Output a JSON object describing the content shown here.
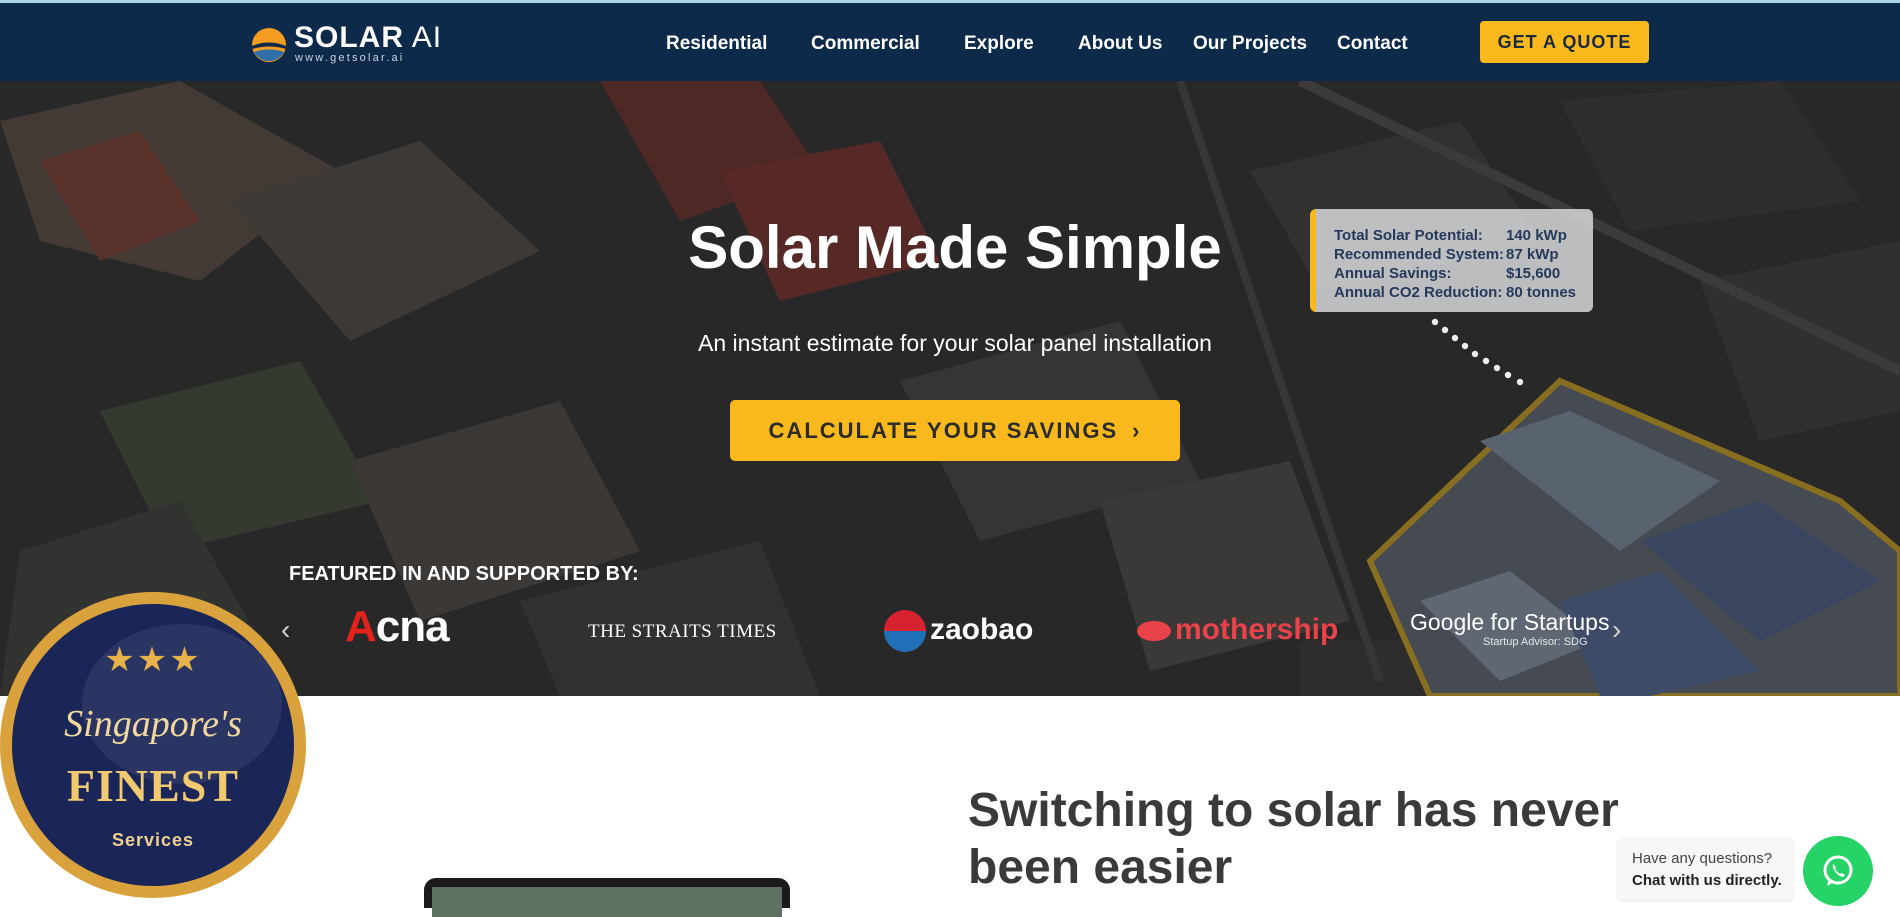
{
  "brand": {
    "name_bold": "SOLAR",
    "name_light": "AI",
    "url": "www.getsolar.ai",
    "accent": "#f9b81b",
    "navy": "#0e2a4a"
  },
  "nav": {
    "items": [
      {
        "label": "Residential"
      },
      {
        "label": "Commercial"
      },
      {
        "label": "Explore"
      },
      {
        "label": "About Us"
      },
      {
        "label": "Our Projects"
      },
      {
        "label": "Contact"
      }
    ],
    "cta": "GET A QUOTE"
  },
  "hero": {
    "title": "Solar Made Simple",
    "subtitle": "An instant estimate for your solar panel installation",
    "cta": "CALCULATE YOUR SAVINGS",
    "cta_icon": "chevron-right-icon"
  },
  "estimate": {
    "rows": [
      {
        "label": "Total Solar Potential:",
        "value": "140 kWp"
      },
      {
        "label": "Recommended System:",
        "value": "87 kWp"
      },
      {
        "label": "Annual Savings:",
        "value": "$15,600"
      },
      {
        "label": "Annual CO2 Reduction:",
        "value": "80 tonnes"
      }
    ]
  },
  "featured": {
    "heading": "FEATURED IN AND SUPPORTED BY:",
    "logos": {
      "cna": "cna",
      "straits": "THE STRAITS TIMES",
      "zaobao": "zaobao",
      "mothership": "mothership",
      "google": "Google for Startups",
      "google_sub": "Startup Advisor: SDG"
    }
  },
  "badge": {
    "script": "Singapore's",
    "finest": "FINEST",
    "services": "Services",
    "stars": "★★★"
  },
  "section": {
    "title": "Switching to solar has never been easier"
  },
  "chat": {
    "line1": "Have any questions?",
    "line2": "Chat with us directly."
  }
}
